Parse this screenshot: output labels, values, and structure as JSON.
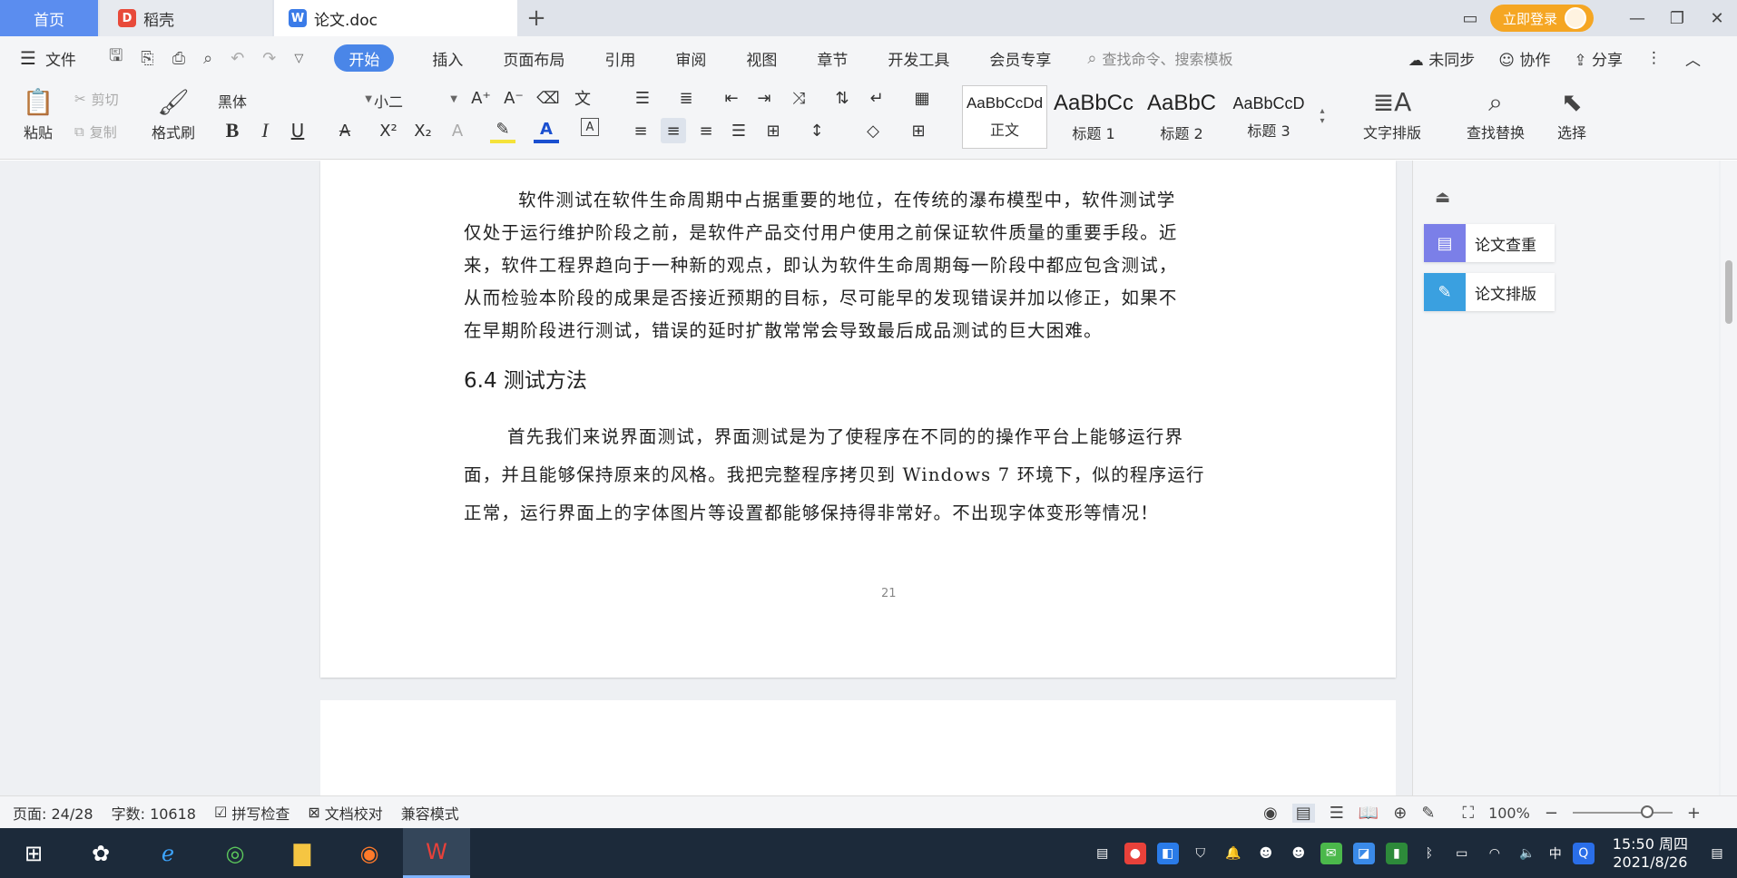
{
  "tabs": {
    "home": "首页",
    "daoke": "稻壳",
    "doc": "论文.doc"
  },
  "title_right": {
    "login": "立即登录"
  },
  "menu": {
    "file": "文件",
    "items": [
      "开始",
      "插入",
      "页面布局",
      "引用",
      "审阅",
      "视图",
      "章节",
      "开发工具",
      "会员专享"
    ],
    "search_placeholder": "查找命令、搜索模板",
    "sync": "未同步",
    "collab": "协作",
    "share": "分享"
  },
  "ribbon": {
    "paste": "粘贴",
    "cut": "剪切",
    "copy": "复制",
    "format_painter": "格式刷",
    "font_name": "黑体",
    "font_size": "小二",
    "styles": [
      {
        "sample": "AaBbCcDd",
        "name": "正文"
      },
      {
        "sample": "AaBbCc",
        "name": "标题 1"
      },
      {
        "sample": "AaBbC",
        "name": "标题 2"
      },
      {
        "sample": "AaBbCcD",
        "name": "标题 3"
      }
    ],
    "text_layout": "文字排版",
    "find_replace": "查找替换",
    "select": "选择"
  },
  "document": {
    "para1_lines": [
      "软件测试在软件生命周期中占据重要的地位，在传统的瀑布模型中，软件测试学",
      "仅处于运行维护阶段之前，是软件产品交付用户使用之前保证软件质量的重要手段。近",
      "来，软件工程界趋向于一种新的观点，即认为软件生命周期每一阶段中都应包含测试，",
      "从而检验本阶段的成果是否接近预期的目标，尽可能早的发现错误并加以修正，如果不",
      "在早期阶段进行测试，错误的延时扩散常常会导致最后成品测试的巨大困难。"
    ],
    "heading": "6.4 测试方法",
    "para2_lines": [
      "首先我们来说界面测试，界面测试是为了使程序在不同的的操作平台上能够运行界",
      "面，并且能够保持原来的风格。我把完整程序拷贝到 Windows 7 环境下，似的程序运行",
      "正常，运行界面上的字体图片等设置都能够保持得非常好。不出现字体变形等情况！"
    ],
    "page_number": "21"
  },
  "side_panel": {
    "check": "论文查重",
    "format": "论文排版"
  },
  "status": {
    "page": "页面: 24/28",
    "words": "字数: 10618",
    "spell": "拼写检查",
    "proof": "文档校对",
    "compat": "兼容模式",
    "zoom": "100%",
    "zoom_level": 0.75
  },
  "taskbar": {
    "time": "15:50 周四",
    "date": "2021/8/26",
    "ime": "中"
  },
  "colors": {
    "accent": "#4a86e8",
    "home_tab": "#5b8def",
    "login": "#f5a623",
    "check_icon": "#7b7fe8",
    "format_icon": "#3aa0e0"
  }
}
